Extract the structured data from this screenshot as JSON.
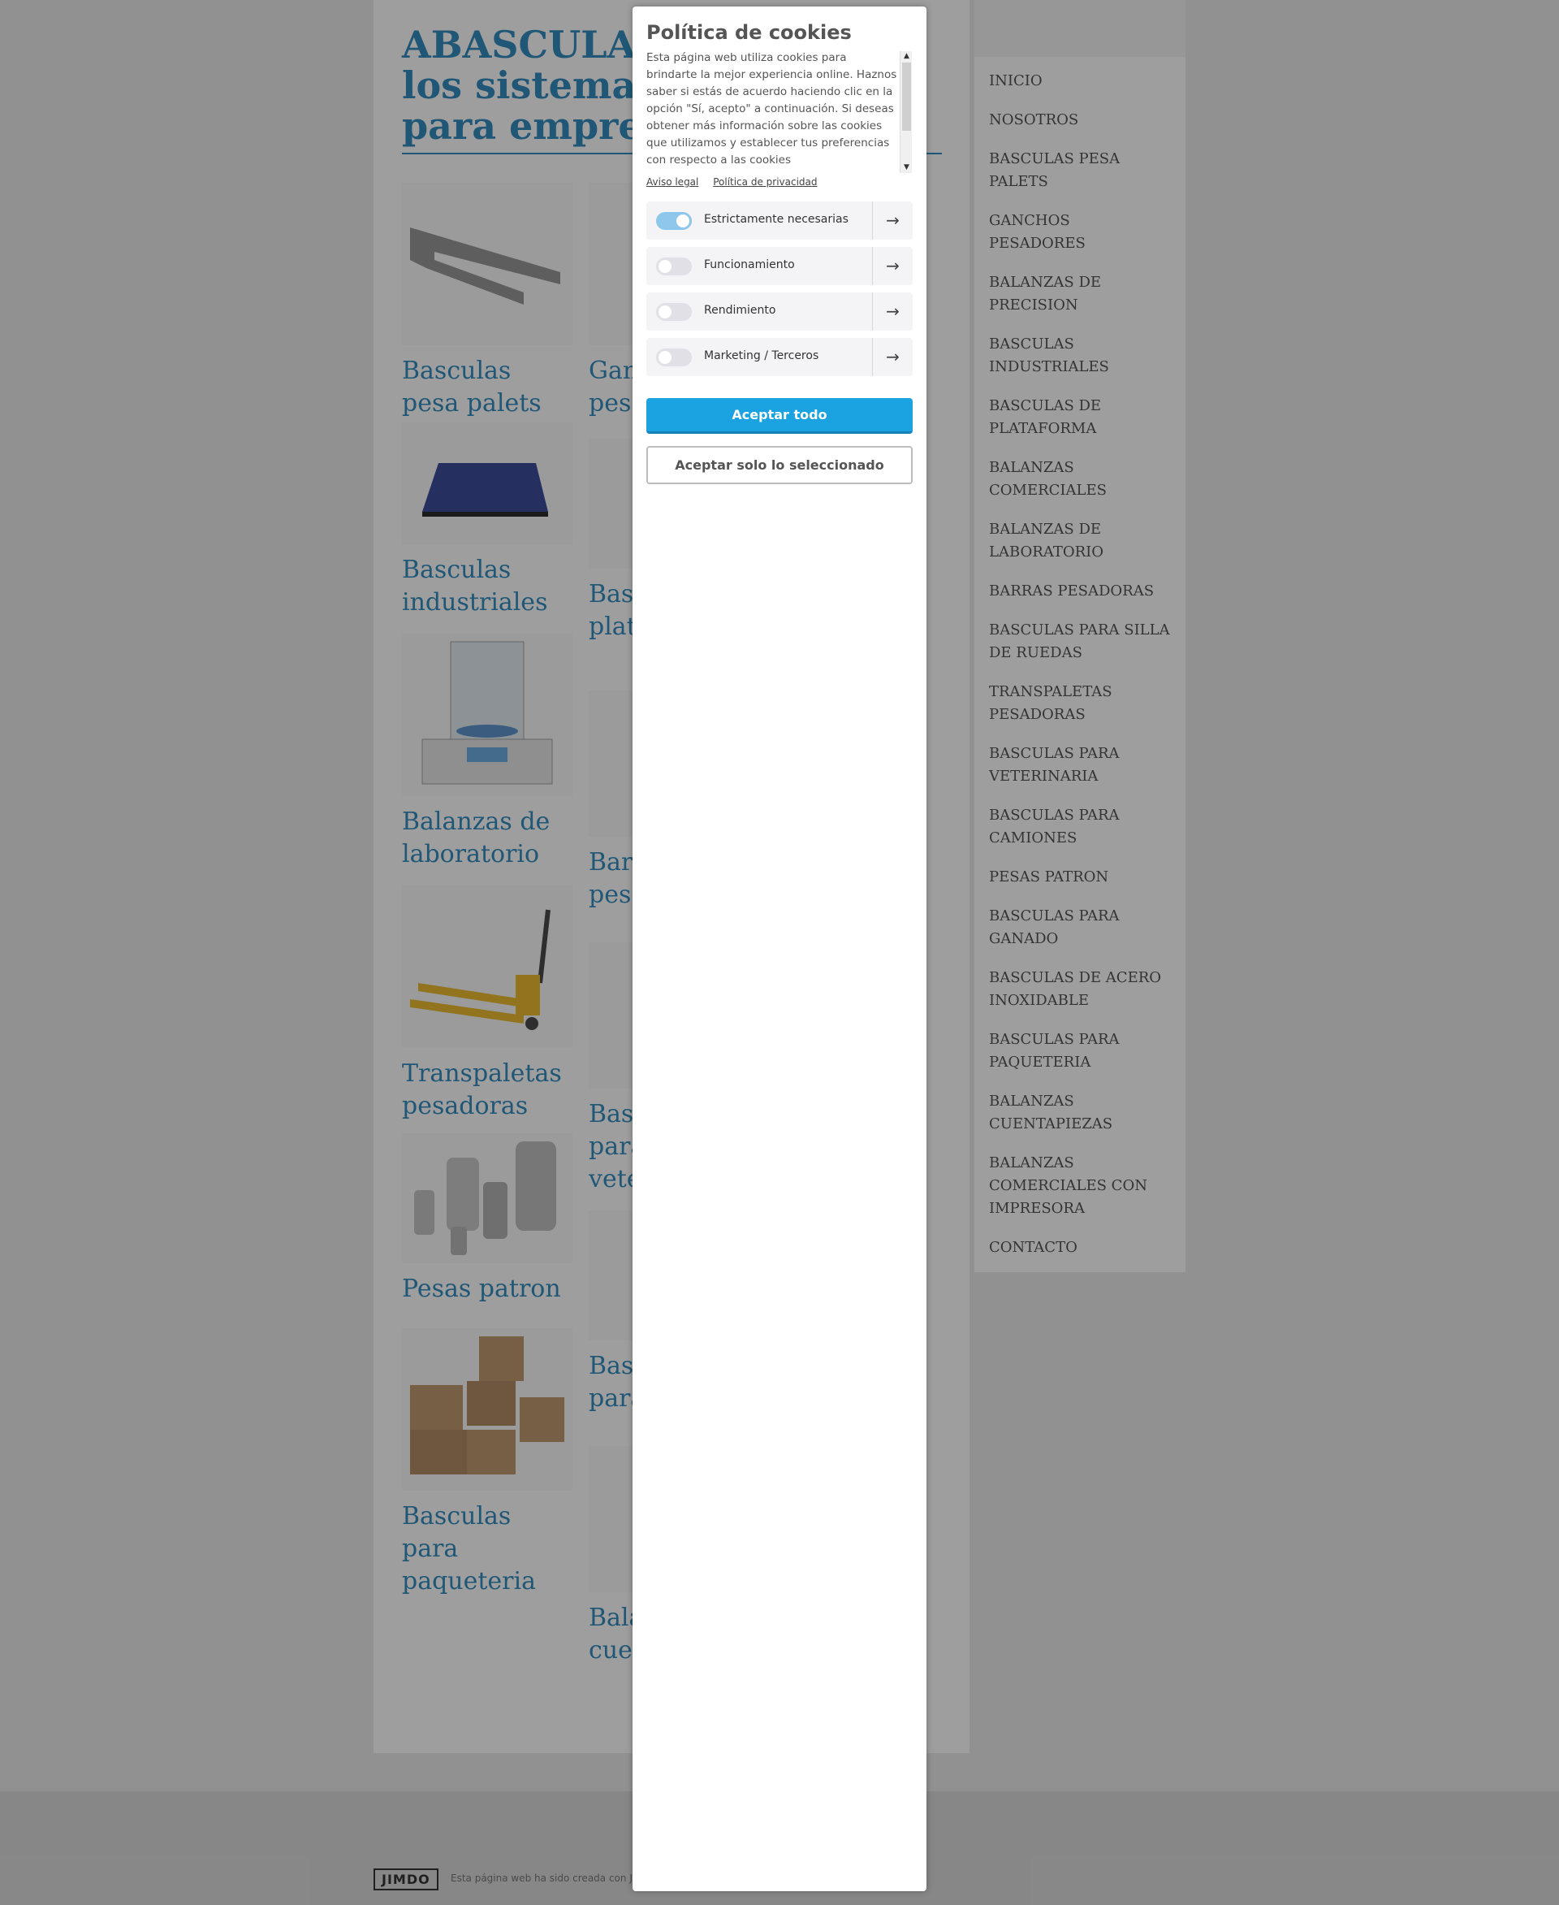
{
  "site": {
    "title": "ABASCULA - Líderes en los sistemas de pesaje para empresas",
    "products": [
      {
        "name": "Basculas pesa palets",
        "icon": "pallet-scale-icon"
      },
      {
        "name": "Ganchos pesadores",
        "icon": "hook-scale-icon"
      },
      {
        "name": "Basculas industriales",
        "icon": "industrial-scale-icon"
      },
      {
        "name": "Basculas de plataforma",
        "icon": "platform-scale-icon"
      },
      {
        "name": "Balanzas de laboratorio",
        "icon": "lab-balance-icon"
      },
      {
        "name": "Barras pesadoras",
        "icon": "weigh-beam-icon"
      },
      {
        "name": "Transpaletas pesadoras",
        "icon": "pallet-truck-icon"
      },
      {
        "name": "Basculas para veterinaria",
        "icon": "vet-scale-icon"
      },
      {
        "name": "Pesas patron",
        "icon": "weights-icon"
      },
      {
        "name": "Basculas para ganado",
        "icon": "livestock-scale-icon"
      },
      {
        "name": "Basculas para paqueteria",
        "icon": "boxes-icon"
      },
      {
        "name": "Balanzas cuentapiezas",
        "icon": "counting-scale-icon"
      }
    ]
  },
  "menu": [
    "INICIO",
    "NOSOTROS",
    "BASCULAS PESA PALETS",
    "GANCHOS PESADORES",
    "BALANZAS DE PRECISION",
    "BASCULAS INDUSTRIALES",
    "BASCULAS DE PLATAFORMA",
    "BALANZAS COMERCIALES",
    "BALANZAS DE LABORATORIO",
    "BARRAS PESADORAS",
    "BASCULAS PARA SILLA DE RUEDAS",
    "TRANSPALETAS PESADORAS",
    "BASCULAS PARA VETERINARIA",
    "BASCULAS PARA CAMIONES",
    "PESAS PATRON",
    "BASCULAS PARA GANADO",
    "BASCULAS DE ACERO INOXIDABLE",
    "BASCULAS PARA PAQUETERIA",
    "BALANZAS CUENTAPIEZAS",
    "BALANZAS COMERCIALES CON IMPRESORA",
    "CONTACTO"
  ],
  "footer": {
    "logo": "JIMDO",
    "text": "Esta página web ha sido creada con Jimdo"
  },
  "cookie_dialog": {
    "title": "Política de cookies",
    "body": "Esta página web utiliza cookies para brindarte la mejor experiencia online. Haznos saber si estás de acuerdo haciendo clic en la opción \"Sí, acepto\" a continuación. Si deseas obtener más información sobre las cookies que utilizamos y establecer tus preferencias con respecto a las cookies",
    "links": {
      "legal": "Aviso legal",
      "privacy": "Política de privacidad"
    },
    "categories": [
      {
        "label": "Estrictamente necesarias",
        "enabled": true
      },
      {
        "label": "Funcionamiento",
        "enabled": false
      },
      {
        "label": "Rendimiento",
        "enabled": false
      },
      {
        "label": "Marketing / Terceros",
        "enabled": false
      }
    ],
    "accept_all": "Aceptar todo",
    "accept_selected": "Aceptar solo lo seleccionado",
    "colors": {
      "accent": "#1aa3e0",
      "toggle_on": "#8dc8ec"
    }
  }
}
